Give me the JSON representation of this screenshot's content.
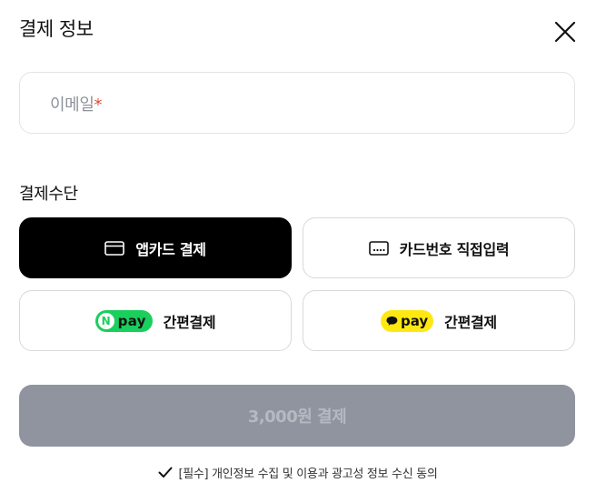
{
  "header": {
    "title": "결제 정보",
    "close_icon": "close-icon"
  },
  "email": {
    "placeholder": "이메일",
    "required_mark": "*",
    "value": ""
  },
  "payment_section": {
    "label": "결제수단",
    "methods": [
      {
        "label": "앱카드 결제",
        "icon": "card-icon",
        "selected": true
      },
      {
        "label": "카드번호 직접입력",
        "icon": "keypad-card-icon",
        "selected": false
      },
      {
        "label": "간편결제",
        "brand": "pay",
        "brand_mark": "N",
        "icon": "naver-pay-icon",
        "selected": false
      },
      {
        "label": "간편결제",
        "brand": "pay",
        "icon": "kakao-pay-icon",
        "selected": false
      }
    ]
  },
  "pay_button": {
    "label": "3,000원 결제",
    "enabled": false
  },
  "consent": {
    "text": "[필수] 개인정보 수집 및 이용과 광고성 정보 수신 동의",
    "checked": true
  },
  "colors": {
    "selected_bg": "#000000",
    "disabled_button": "#8f949e",
    "required": "#e5493a",
    "naver": "#19cf5d",
    "kakao": "#ffe812"
  }
}
